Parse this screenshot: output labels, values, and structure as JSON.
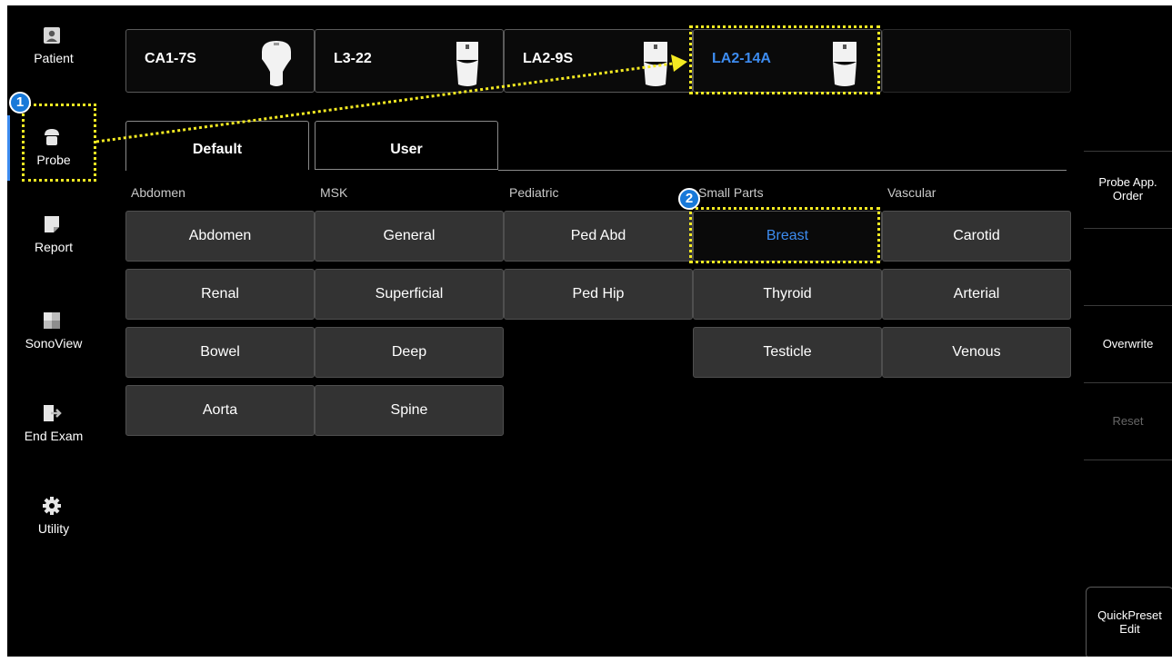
{
  "nav": {
    "items": [
      {
        "label": "Patient",
        "icon": "patient-icon"
      },
      {
        "label": "Probe",
        "icon": "probe-icon"
      },
      {
        "label": "Report",
        "icon": "report-icon"
      },
      {
        "label": "SonoView",
        "icon": "sonoview-icon"
      },
      {
        "label": "End Exam",
        "icon": "end-exam-icon"
      },
      {
        "label": "Utility",
        "icon": "gear-icon"
      }
    ],
    "active": "Probe"
  },
  "probes": [
    {
      "name": "CA1-7S",
      "selected": false
    },
    {
      "name": "L3-22",
      "selected": false
    },
    {
      "name": "LA2-9S",
      "selected": false
    },
    {
      "name": "LA2-14A",
      "selected": true
    }
  ],
  "tabs": {
    "default": "Default",
    "user": "User",
    "active": "Default"
  },
  "categories": [
    {
      "name": "Abdomen",
      "presets": [
        "Abdomen",
        "Renal",
        "Bowel",
        "Aorta"
      ]
    },
    {
      "name": "MSK",
      "presets": [
        "General",
        "Superficial",
        "Deep",
        "Spine"
      ]
    },
    {
      "name": "Pediatric",
      "presets": [
        "Ped Abd",
        "Ped Hip"
      ]
    },
    {
      "name": "Small Parts",
      "presets": [
        "Breast",
        "Thyroid",
        "Testicle"
      ]
    },
    {
      "name": "Vascular",
      "presets": [
        "Carotid",
        "Arterial",
        "Venous"
      ]
    }
  ],
  "selected_preset": "Breast",
  "right_panel": {
    "probe_app_order": "Probe App.\nOrder",
    "overwrite": "Overwrite",
    "reset": "Reset",
    "quickpreset_edit": "QuickPreset\nEdit"
  },
  "annotations": {
    "step1": "1",
    "step2": "2"
  },
  "colors": {
    "accent": "#3d8cf0",
    "highlight": "#f4ea22",
    "badge": "#1879d9",
    "button_bg": "#333333",
    "background": "#000000"
  }
}
